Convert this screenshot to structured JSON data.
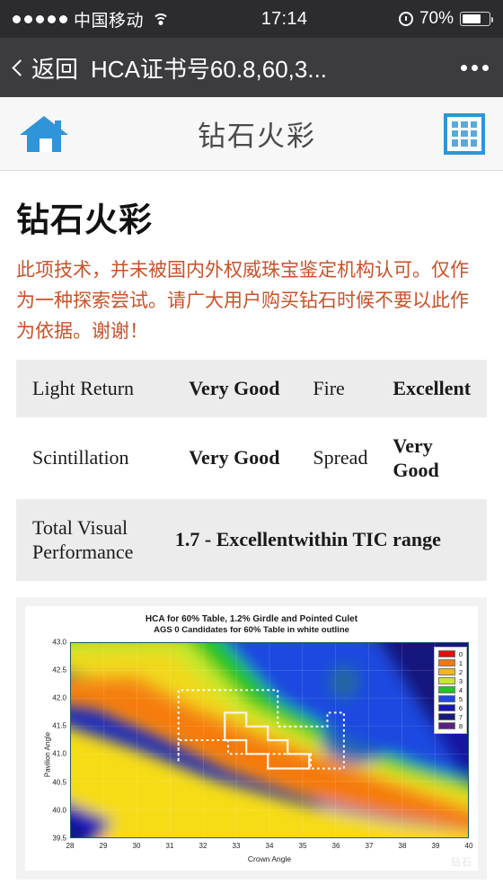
{
  "status_bar": {
    "signal_dots": 5,
    "carrier": "中国移动",
    "wifi_icon": "wifi-icon",
    "time": "17:14",
    "alarm_icon": "alarm-clock-icon",
    "battery_percent": "70%",
    "battery_level": 70
  },
  "nav_bar": {
    "back_icon": "chevron-left-icon",
    "back_label": "返回",
    "title": "HCA证书号60.8,60,3...",
    "more_icon": "more-dots-icon"
  },
  "app_header": {
    "home_icon": "home-icon",
    "title": "钻石火彩",
    "grid_icon": "grid-menu-icon",
    "accent_color": "#2f95d8"
  },
  "content": {
    "page_title": "钻石火彩",
    "warning": "此项技术，并未被国内外权威珠宝鉴定机构认可。仅作为一种探索尝试。请广大用户购买钻石时候不要以此作为依据。谢谢！",
    "warning_color": "#c8522a"
  },
  "results_table": {
    "rows": [
      {
        "label_a": "Light Return",
        "value_a": "Very Good",
        "label_b": "Fire",
        "value_b": "Excellent",
        "shaded": true
      },
      {
        "label_a": "Scintillation",
        "value_a": "Very Good",
        "label_b": "Spread",
        "value_b": "Very Good",
        "shaded": false
      }
    ],
    "total_row": {
      "label": "Total Visual Performance",
      "value": "1.7 - Excellentwithin TIC  range",
      "shaded": true
    }
  },
  "chart_data": {
    "type": "heatmap",
    "title": "HCA for 60% Table, 1.2% Girdle and Pointed Culet",
    "subtitle": "AGS 0 Candidates for 60% Table in white outline",
    "xlabel": "Crown Angle",
    "ylabel": "Pavilion Angle",
    "xlim": [
      28,
      40
    ],
    "ylim": [
      39.5,
      43.0
    ],
    "xticks": [
      28,
      29,
      30,
      31,
      32,
      33,
      34,
      35,
      36,
      37,
      38,
      39,
      40
    ],
    "yticks": [
      "39.5",
      "40.0",
      "40.5",
      "41.0",
      "41.5",
      "42.0",
      "42.5",
      "43.0"
    ],
    "grid": true,
    "legend_position": "top-right",
    "legend": [
      {
        "label": "0",
        "color": "#e80c0c"
      },
      {
        "label": "1",
        "color": "#f07818"
      },
      {
        "label": "2",
        "color": "#f0b81c"
      },
      {
        "label": "3",
        "color": "#c8e82c"
      },
      {
        "label": "4",
        "color": "#24c424"
      },
      {
        "label": "5",
        "color": "#1c48e0"
      },
      {
        "label": "6",
        "color": "#1818b4"
      },
      {
        "label": "7",
        "color": "#18187c"
      },
      {
        "label": "8",
        "color": "#5c2080"
      }
    ],
    "colorbar_levels": [
      0,
      1,
      2,
      3,
      4,
      5,
      6,
      7,
      8
    ],
    "value_note": "HCA score: lower (red/orange) is better, higher (blue/purple) is worse",
    "ags0_outline_note": "dotted white polyline marks AGS 0 candidate region",
    "best_zone_note": "solid white staircase marks best HCA zone, crown 32.5-34.5, pavilion 40.5-41.25"
  },
  "watermark": "钻石"
}
